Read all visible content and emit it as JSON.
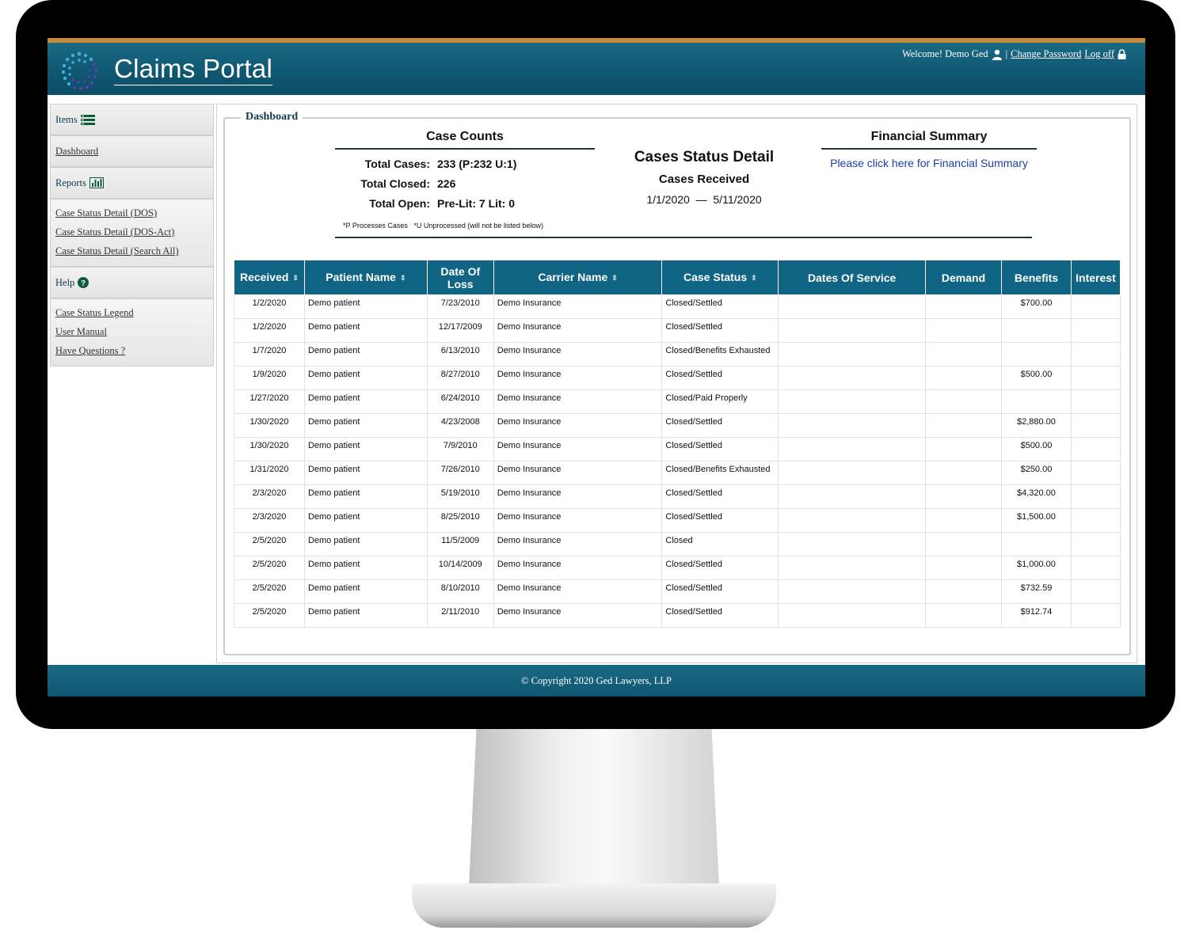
{
  "header": {
    "app_title": "Claims Portal",
    "welcome": "Welcome! Demo Ged",
    "separator": "|",
    "change_password": "Change Password",
    "log_off": "Log off"
  },
  "sidebar": {
    "items_label": "Items",
    "dashboard_label": "Dashboard",
    "reports_label": "Reports",
    "reports_links": [
      "Case Status Detail (DOS)",
      "Case Status Detail (DOS-Act)",
      "Case Status Detail (Search All)"
    ],
    "help_label": "Help",
    "help_links": [
      "Case Status Legend",
      "User Manual",
      "Have Questions ?"
    ]
  },
  "dashboard": {
    "legend": "Dashboard",
    "case_counts": {
      "title": "Case Counts",
      "total_cases_label": "Total Cases:",
      "total_cases_value": "233 (P:232 U:1)",
      "total_closed_label": "Total Closed:",
      "total_closed_value": "226",
      "total_open_label": "Total Open:",
      "total_open_value": "Pre-Lit: 7 Lit: 0",
      "note": "*P Processes Cases   *U Unprocessed (will not be listed below)"
    },
    "status_detail": {
      "title": "Cases Status Detail",
      "subtitle": "Cases Received",
      "date_range": "1/1/2020  —  5/11/2020"
    },
    "financial": {
      "title": "Financial Summary",
      "link": "Please click here for Financial Summary"
    }
  },
  "table": {
    "columns": {
      "received": "Received",
      "patient": "Patient Name",
      "dol_line1": "Date Of",
      "dol_line2": "Loss",
      "carrier": "Carrier Name",
      "status": "Case Status",
      "dos": "Dates Of Service",
      "demand": "Demand",
      "benefits": "Benefits",
      "interest": "Interest"
    },
    "rows": [
      {
        "received": "1/2/2020",
        "patient": "Demo patient",
        "dol": "7/23/2010",
        "carrier": "Demo Insurance",
        "status": "Closed/Settled",
        "benefits": "$700.00"
      },
      {
        "received": "1/2/2020",
        "patient": "Demo patient",
        "dol": "12/17/2009",
        "carrier": "Demo Insurance",
        "status": "Closed/Settled",
        "benefits": ""
      },
      {
        "received": "1/7/2020",
        "patient": "Demo patient",
        "dol": "6/13/2010",
        "carrier": "Demo Insurance",
        "status": "Closed/Benefits Exhausted",
        "benefits": ""
      },
      {
        "received": "1/9/2020",
        "patient": "Demo patient",
        "dol": "8/27/2010",
        "carrier": "Demo Insurance",
        "status": "Closed/Settled",
        "benefits": "$500.00"
      },
      {
        "received": "1/27/2020",
        "patient": "Demo patient",
        "dol": "6/24/2010",
        "carrier": "Demo Insurance",
        "status": "Closed/Paid Properly",
        "benefits": ""
      },
      {
        "received": "1/30/2020",
        "patient": "Demo patient",
        "dol": "4/23/2008",
        "carrier": "Demo Insurance",
        "status": "Closed/Settled",
        "benefits": "$2,880.00"
      },
      {
        "received": "1/30/2020",
        "patient": "Demo patient",
        "dol": "7/9/2010",
        "carrier": "Demo Insurance",
        "status": "Closed/Settled",
        "benefits": "$500.00"
      },
      {
        "received": "1/31/2020",
        "patient": "Demo patient",
        "dol": "7/26/2010",
        "carrier": "Demo Insurance",
        "status": "Closed/Benefits Exhausted",
        "benefits": "$250.00"
      },
      {
        "received": "2/3/2020",
        "patient": "Demo patient",
        "dol": "5/19/2010",
        "carrier": "Demo Insurance",
        "status": "Closed/Settled",
        "benefits": "$4,320.00"
      },
      {
        "received": "2/3/2020",
        "patient": "Demo patient",
        "dol": "8/25/2010",
        "carrier": "Demo Insurance",
        "status": "Closed/Settled",
        "benefits": "$1,500.00"
      },
      {
        "received": "2/5/2020",
        "patient": "Demo patient",
        "dol": "11/5/2009",
        "carrier": "Demo Insurance",
        "status": "Closed",
        "benefits": ""
      },
      {
        "received": "2/5/2020",
        "patient": "Demo patient",
        "dol": "10/14/2009",
        "carrier": "Demo Insurance",
        "status": "Closed/Settled",
        "benefits": "$1,000.00"
      },
      {
        "received": "2/5/2020",
        "patient": "Demo patient",
        "dol": "8/10/2010",
        "carrier": "Demo Insurance",
        "status": "Closed/Settled",
        "benefits": "$732.59"
      },
      {
        "received": "2/5/2020",
        "patient": "Demo patient",
        "dol": "2/11/2010",
        "carrier": "Demo Insurance",
        "status": "Closed/Settled",
        "benefits": "$912.74"
      }
    ]
  },
  "footer": {
    "copyright": "© Copyright 2020 Ged Lawyers, LLP"
  },
  "colors": {
    "header": "#0f5670",
    "accent_stripe": "#c58a3a",
    "table_header": "#0f6583",
    "link_blue": "#1a3ea8",
    "rule_green": "#1e3d2f"
  },
  "icons": {
    "items": "list-icon",
    "reports": "bar-chart-icon",
    "help": "question-circle-icon",
    "user": "user-icon",
    "lock": "lock-icon",
    "sort": "sort-icon"
  }
}
